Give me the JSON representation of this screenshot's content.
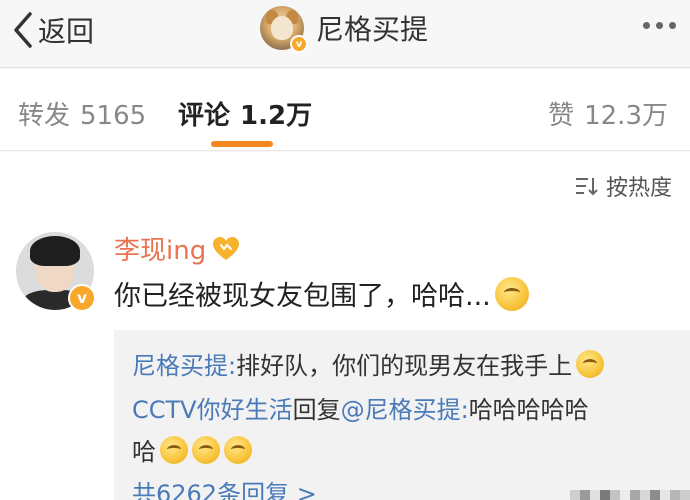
{
  "navbar": {
    "back_label": "返回",
    "title": "尼格买提",
    "verified_mark": "v"
  },
  "tabs": {
    "forward_label": "转发",
    "forward_count": "5165",
    "comment_label": "评论",
    "comment_count": "1.2万",
    "like_label": "赞",
    "like_count": "12.3万",
    "accent_color": "#f5871f"
  },
  "sort": {
    "label": "按热度"
  },
  "comment": {
    "username": "李现ing",
    "verified_mark": "v",
    "text": "你已经被现女友包围了，哈哈...",
    "replies": [
      {
        "author": "尼格买提:",
        "text": " 排好队，你们的现男友在我手上"
      },
      {
        "author": "CCTV你好生活",
        "text": "回复",
        "mention": "@尼格买提:",
        "text2": "哈哈哈哈哈",
        "text3": "哈"
      }
    ],
    "more_replies": "共6262条回复 >"
  },
  "colors": {
    "username": "#eb7350",
    "link": "#4a7ab8",
    "verified_badge": "#f7a72a"
  }
}
